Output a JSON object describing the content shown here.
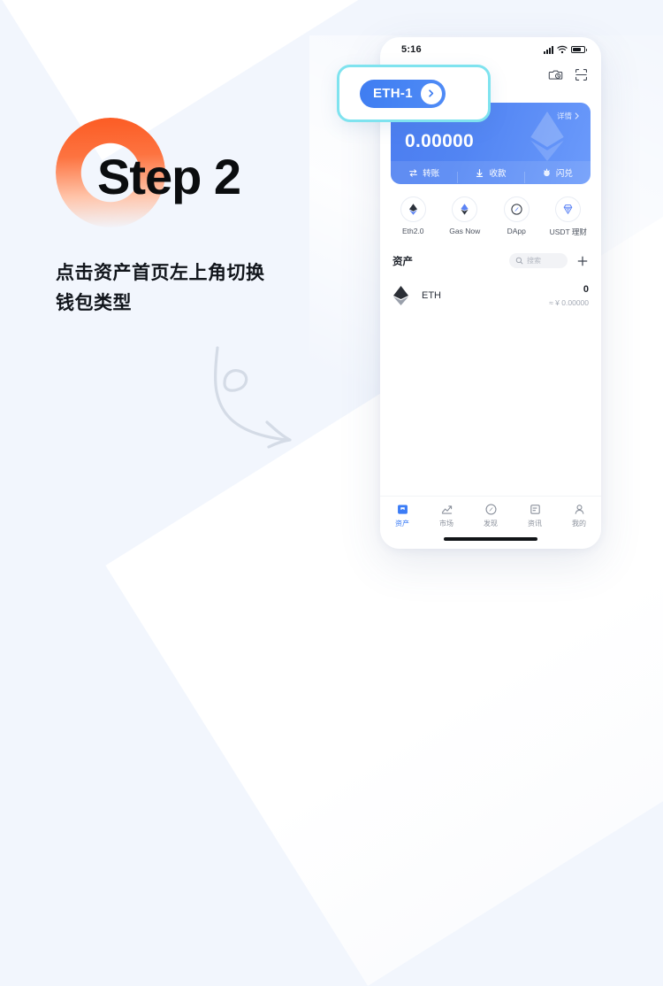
{
  "tutorial": {
    "step_title": "Step 2",
    "description_line1": "点击资产首页左上角切换",
    "description_line2": "钱包类型",
    "accent_color": "#fc5b23",
    "highlight_border_color": "#7fe3ef",
    "arrow_icon": "curly-arrow-icon"
  },
  "phone": {
    "status_bar": {
      "time": "5:16",
      "signal_icon": "signal-bars-icon",
      "wifi_icon": "wifi-icon",
      "battery_icon": "battery-icon"
    },
    "header": {
      "wallet_name": "ETH-1",
      "wallet_chevron_icon": "chevron-right-icon",
      "history_icon": "camera-history-icon",
      "scan_icon": "scan-qr-icon"
    },
    "balance_card": {
      "detail_label": "详情",
      "detail_chevron_icon": "chevron-right-icon",
      "balance_value": "0.00000",
      "watermark_icon": "ethereum-diamond-icon",
      "accent_color": "#4b7df0",
      "actions": [
        {
          "label": "转账",
          "icon": "transfer-icon"
        },
        {
          "label": "收款",
          "icon": "receive-icon"
        },
        {
          "label": "闪兑",
          "icon": "swap-icon"
        }
      ]
    },
    "shortcuts": [
      {
        "label": "Eth2.0",
        "icon": "eth2-icon"
      },
      {
        "label": "Gas Now",
        "icon": "gas-icon"
      },
      {
        "label": "DApp",
        "icon": "compass-icon"
      },
      {
        "label": "USDT 理财",
        "icon": "usdt-gem-icon"
      }
    ],
    "assets": {
      "title": "资产",
      "search_placeholder": "搜索",
      "search_icon": "search-icon",
      "add_icon": "plus-icon",
      "rows": [
        {
          "icon": "ethereum-diamond-icon",
          "name": "ETH",
          "amount": "0",
          "fiat": "≈ ¥ 0.00000"
        }
      ]
    },
    "tabbar": [
      {
        "label": "资产",
        "icon": "wallet-icon",
        "active": true
      },
      {
        "label": "市场",
        "icon": "chart-icon",
        "active": false
      },
      {
        "label": "发现",
        "icon": "compass-icon",
        "active": false
      },
      {
        "label": "资讯",
        "icon": "news-icon",
        "active": false
      },
      {
        "label": "我的",
        "icon": "person-icon",
        "active": false
      }
    ]
  }
}
